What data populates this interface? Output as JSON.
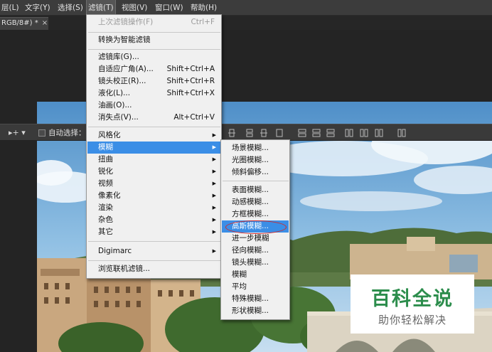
{
  "menubar": {
    "items": [
      {
        "label": "层(L)"
      },
      {
        "label": "文字(Y)"
      },
      {
        "label": "选择(S)"
      },
      {
        "label": "滤镜(T)"
      },
      {
        "label": "视图(V)"
      },
      {
        "label": "窗口(W)"
      },
      {
        "label": "帮助(H)"
      }
    ]
  },
  "doc_tab": {
    "label": "RGB/8#) *",
    "close": "×"
  },
  "options_bar": {
    "auto_select_label": "自动选择："
  },
  "filter_menu": {
    "last_filter": {
      "label": "上次滤镜操作(F)",
      "shortcut": "Ctrl+F"
    },
    "smart_filter": "转换为智能滤镜",
    "group2": [
      {
        "label": "滤镜库(G)...",
        "shortcut": ""
      },
      {
        "label": "自适应广角(A)...",
        "shortcut": "Shift+Ctrl+A"
      },
      {
        "label": "镜头校正(R)...",
        "shortcut": "Shift+Ctrl+R"
      },
      {
        "label": "液化(L)...",
        "shortcut": "Shift+Ctrl+X"
      },
      {
        "label": "油画(O)...",
        "shortcut": ""
      },
      {
        "label": "消失点(V)...",
        "shortcut": "Alt+Ctrl+V"
      }
    ],
    "group3": [
      "风格化",
      "模糊",
      "扭曲",
      "锐化",
      "视频",
      "像素化",
      "渲染",
      "杂色",
      "其它"
    ],
    "digimarc": "Digimarc",
    "browse": "浏览联机滤镜...",
    "arrow": "▶"
  },
  "blur_submenu": {
    "group1": [
      "场景模糊...",
      "光圈模糊...",
      "倾斜偏移..."
    ],
    "group2": [
      "表面模糊...",
      "动感模糊...",
      "方框模糊...",
      "高斯模糊...",
      "进一步模糊",
      "径向模糊...",
      "镜头模糊...",
      "模糊",
      "平均",
      "特殊模糊...",
      "形状模糊..."
    ]
  },
  "watermark": {
    "title": "百科全说",
    "subtitle": "助你轻松解决"
  },
  "colors": {
    "highlight": "#3b8ee6",
    "annotation": "#d12a2a",
    "watermark_green": "#2c8d4c"
  }
}
